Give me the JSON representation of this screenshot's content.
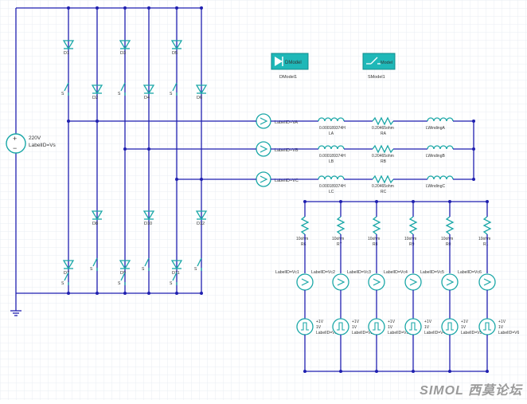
{
  "colors": {
    "wire": "#1f1fb0",
    "comp": "#1aa7a7",
    "grid": "#e8edf3",
    "label": "#333333"
  },
  "source": {
    "value": "220V",
    "label": "LabelID=Vs"
  },
  "models": [
    {
      "name": "DModel1",
      "icon": "diode-model-icon"
    },
    {
      "name": "SModel1",
      "icon": "switch-model-icon"
    }
  ],
  "diodes_top": [
    "D1",
    "D3",
    "D5"
  ],
  "diodes_top_b": [
    "D2",
    "D4",
    "D6"
  ],
  "diodes_bot": [
    "D8",
    "D10",
    "D12"
  ],
  "diodes_bot_b": [
    "D7",
    "D9",
    "D11"
  ],
  "phases": [
    {
      "meter": "LabelID=VA",
      "ind_value": "0.000189374H",
      "ind": "LA",
      "res_value": "0.20465ohm",
      "res": "RA",
      "winding": "LWindingA"
    },
    {
      "meter": "LabelID=VB",
      "ind_value": "0.000189374H",
      "ind": "LB",
      "res_value": "0.20465ohm",
      "res": "RB",
      "winding": "LWindingB"
    },
    {
      "meter": "LabelID=VC",
      "ind_value": "0.000189374H",
      "ind": "LC",
      "res_value": "0.20465ohm",
      "res": "RC",
      "winding": "LWindingC"
    }
  ],
  "resistors": [
    {
      "value": "10ohm",
      "name": "R6"
    },
    {
      "value": "10ohm",
      "name": "R7"
    },
    {
      "value": "10ohm",
      "name": "R8"
    },
    {
      "value": "10ohm",
      "name": "R9"
    },
    {
      "value": "10ohm",
      "name": "R0"
    },
    {
      "value": "10ohm",
      "name": "R1"
    }
  ],
  "vmeters": [
    "LabelID=Vc1",
    "LabelID=Vc2",
    "LabelID=Vc3",
    "LabelID=Vc4",
    "LabelID=Vc5",
    "LabelID=Vc6"
  ],
  "pulses": [
    {
      "v1": "+1V",
      "v2": "1V",
      "label": "LabelID=V1"
    },
    {
      "v1": "+1V",
      "v2": "1V",
      "label": "LabelID=V2"
    },
    {
      "v1": "+1V",
      "v2": "1V",
      "label": "LabelID=V3"
    },
    {
      "v1": "+1V",
      "v2": "1V",
      "label": "LabelID=V4"
    },
    {
      "v1": "+1V",
      "v2": "1V",
      "label": "LabelID=V5"
    },
    {
      "v1": "+1V",
      "v2": "1V",
      "label": "LabelID=V6"
    }
  ],
  "watermark": "SIMOL 西莫论坛"
}
